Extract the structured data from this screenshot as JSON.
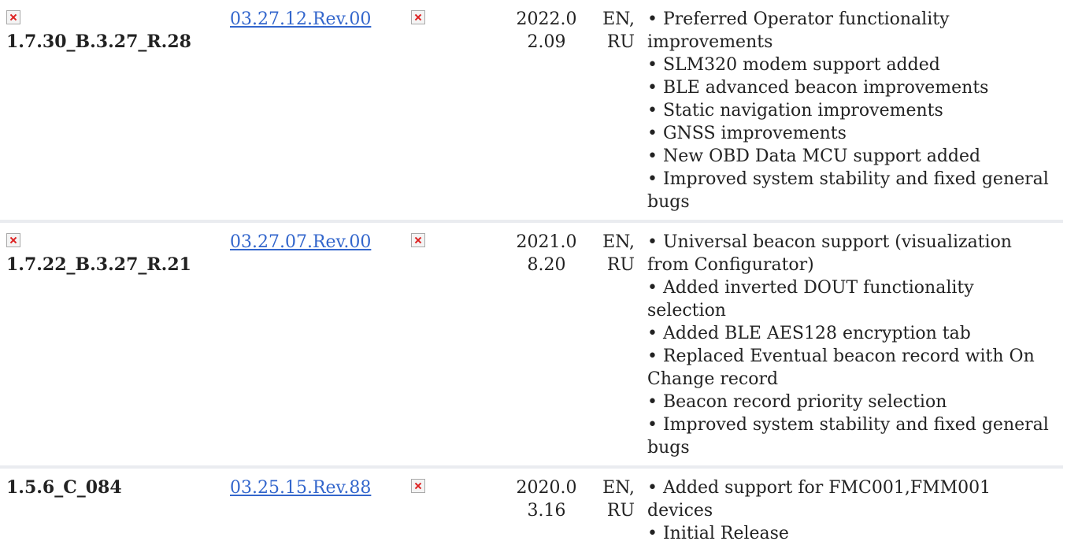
{
  "rows": [
    {
      "version": "1.7.30_B.3.27_R.28",
      "has_icon": true,
      "config": "03.27.12.Rev.00",
      "date": "2022.02.09",
      "languages": "EN, RU",
      "notes": [
        "• Preferred Operator functionality improvements",
        "• SLM320 modem support added",
        "• BLE advanced beacon improvements",
        "• Static navigation improvements",
        "• GNSS improvements",
        "• New OBD Data MCU support added",
        "• Improved system stability and fixed general bugs"
      ]
    },
    {
      "version": "1.7.22_B.3.27_R.21",
      "has_icon": true,
      "config": "03.27.07.Rev.00",
      "date": "2021.08.20",
      "languages": "EN, RU",
      "notes": [
        "• Universal beacon support (visualization from Configurator)",
        "• Added inverted DOUT functionality selection",
        "• Added BLE AES128 encryption tab",
        "• Replaced Eventual beacon record with On Change record",
        "• Beacon record priority selection",
        "• Improved system stability and fixed general bugs"
      ]
    },
    {
      "version": "1.5.6_C_084",
      "has_icon": false,
      "config": "03.25.15.Rev.88",
      "date": "2020.03.16",
      "languages": "EN, RU",
      "notes": [
        "• Added support for FMC001,FMM001 devices",
        "• Initial Release"
      ]
    }
  ]
}
